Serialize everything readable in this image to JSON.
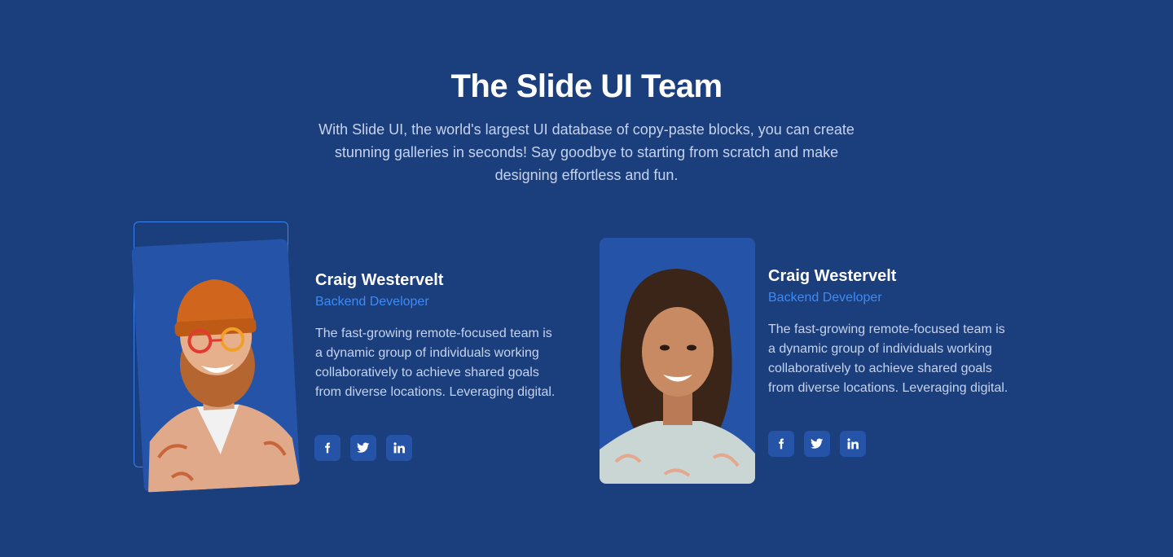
{
  "header": {
    "title": "The Slide UI Team",
    "subtitle": "With Slide UI, the world's largest UI database of copy-paste blocks, you can create stunning galleries in seconds! Say goodbye to starting from scratch and make designing effortless and fun."
  },
  "members": [
    {
      "name": "Craig Westervelt",
      "role": "Backend Developer",
      "bio": "The fast-growing remote-focused team is a dynamic group of individuals working collaboratively to achieve shared goals from diverse locations. Leveraging digital.",
      "socials": [
        "facebook-icon",
        "twitter-icon",
        "linkedin-icon"
      ]
    },
    {
      "name": "Craig Westervelt",
      "role": "Backend Developer",
      "bio": "The fast-growing remote-focused team is a dynamic group of individuals working collaboratively to achieve shared goals from diverse locations. Leveraging digital.",
      "socials": [
        "facebook-icon",
        "twitter-icon",
        "linkedin-icon"
      ]
    }
  ],
  "colors": {
    "background": "#1b3e7d",
    "card": "#2453a8",
    "accent": "#3d8bf5",
    "text_muted": "#c6d3ee"
  }
}
